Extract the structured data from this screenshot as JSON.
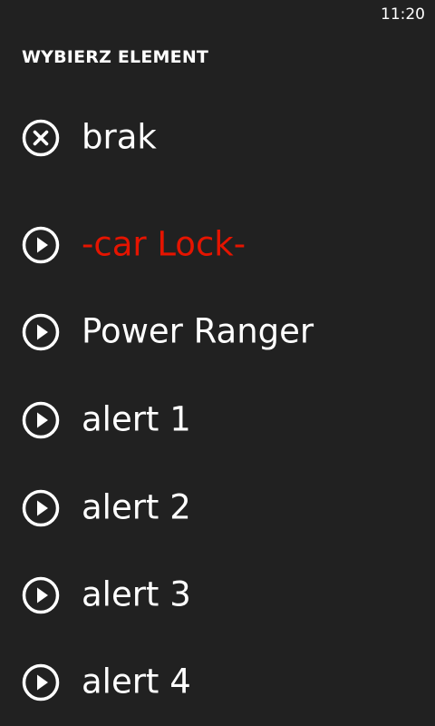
{
  "status": {
    "time": "11:20"
  },
  "page": {
    "title": "WYBIERZ ELEMENT"
  },
  "none_option": {
    "label": "brak",
    "icon": "close-circle-icon"
  },
  "items": [
    {
      "label": "-car Lock-",
      "icon": "play-circle-icon",
      "selected": true
    },
    {
      "label": "Power Ranger",
      "icon": "play-circle-icon",
      "selected": false
    },
    {
      "label": "alert 1",
      "icon": "play-circle-icon",
      "selected": false
    },
    {
      "label": "alert 2",
      "icon": "play-circle-icon",
      "selected": false
    },
    {
      "label": "alert 3",
      "icon": "play-circle-icon",
      "selected": false
    },
    {
      "label": "alert 4",
      "icon": "play-circle-icon",
      "selected": false
    }
  ],
  "colors": {
    "background": "#212121",
    "foreground": "#ffffff",
    "accent": "#e51400"
  }
}
